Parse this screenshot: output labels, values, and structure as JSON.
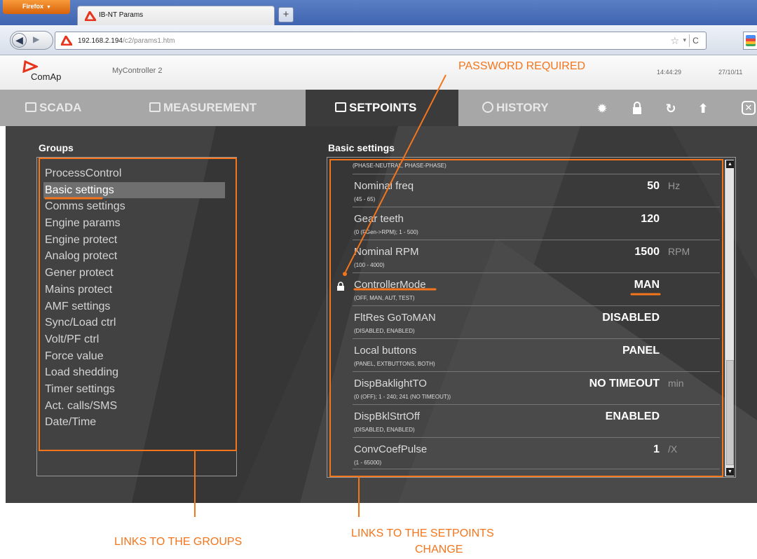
{
  "browser": {
    "menu_label": "Firefox",
    "tab_title": "IB-NT Params",
    "new_tab_symbol": "+",
    "url_domain": "192.168.2.194",
    "url_path": "/c2/params1.htm",
    "icons": [
      "back-arrow-icon",
      "forward-arrow-icon",
      "comap-favicon",
      "bookmark-star-icon",
      "reload-icon",
      "google-search-icon"
    ]
  },
  "app": {
    "logo_text": "ComAp",
    "controller_name": "MyController 2",
    "clock_time": "14:44:29",
    "clock_date": "27/10/11",
    "accent_color": "#e8341c",
    "nav_tabs": [
      {
        "label": "SCADA",
        "icon": "scada-icon"
      },
      {
        "label": "MEASUREMENT",
        "icon": "measurement-icon"
      },
      {
        "label": "SETPOINTS",
        "icon": "setpoints-icon",
        "active": true
      },
      {
        "label": "HISTORY",
        "icon": "history-icon"
      }
    ],
    "toolbar_icons": [
      "settings-gear-icon",
      "lock-icon",
      "refresh-icon",
      "upload-arrow-icon",
      "close-icon"
    ]
  },
  "groups": {
    "heading": "Groups",
    "items": [
      "ProcessControl",
      "Basic settings",
      "Comms settings",
      "Engine params",
      "Engine protect",
      "Analog protect",
      "Gener protect",
      "Mains protect",
      "AMF settings",
      "Sync/Load ctrl",
      "Volt/PF ctrl",
      "Force value",
      "Load shedding",
      "Timer settings",
      "Act. calls/SMS",
      "Date/Time"
    ],
    "active_index": 1
  },
  "settings": {
    "heading": "Basic settings",
    "top_range": "(PHASE-NEUTRAL, PHASE-PHASE)",
    "rows": [
      {
        "name": "Nominal freq",
        "range": "(45 - 65)",
        "value": "50",
        "unit": "Hz"
      },
      {
        "name": "Gear teeth",
        "range": "(0 (FGen->RPM); 1 - 500)",
        "value": "120",
        "unit": ""
      },
      {
        "name": "Nominal RPM",
        "range": "(100 - 4000)",
        "value": "1500",
        "unit": "RPM"
      },
      {
        "name": "ControllerMode",
        "range": "(OFF, MAN, AUT, TEST)",
        "value": "MAN",
        "unit": "",
        "locked": true
      },
      {
        "name": "FltRes GoToMAN",
        "range": "(DISABLED, ENABLED)",
        "value": "DISABLED",
        "unit": ""
      },
      {
        "name": "Local buttons",
        "range": "(PANEL, EXTBUTTONS, BOTH)",
        "value": "PANEL",
        "unit": ""
      },
      {
        "name": "DispBaklightTO",
        "range": "(0 (OFF); 1 - 240; 241 (NO TIMEOUT))",
        "value": "NO TIMEOUT",
        "unit": "min"
      },
      {
        "name": "DispBklStrtOff",
        "range": "(DISABLED, ENABLED)",
        "value": "ENABLED",
        "unit": ""
      },
      {
        "name": "ConvCoefPulse",
        "range": "(1 - 65000)",
        "value": "1",
        "unit": "/X"
      }
    ]
  },
  "annotations": {
    "color": "#f4751b",
    "password_required": "PASSWORD REQUIRED",
    "links_groups": "LINKS TO THE GROUPS",
    "links_setpoints_line1": "LINKS TO THE SETPOINTS",
    "links_setpoints_line2": "CHANGE"
  }
}
